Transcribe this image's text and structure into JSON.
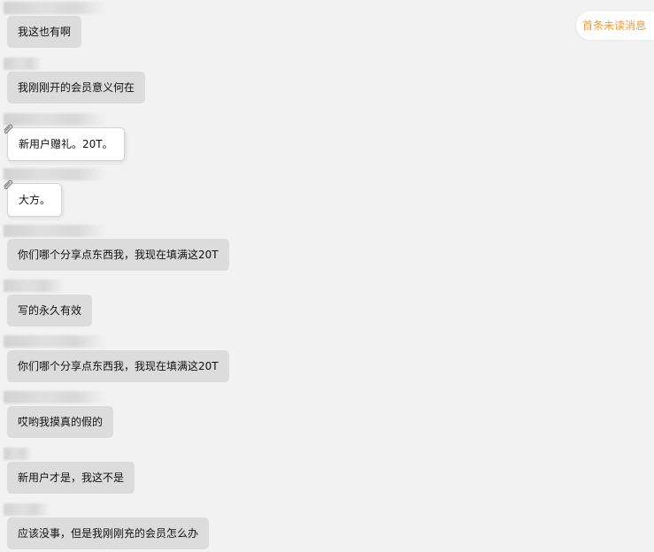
{
  "unread_label": "首条未读消息",
  "messages": [
    {
      "text": "我这也有啊"
    },
    {
      "text": "我刚刚开的会员意义何在"
    },
    {
      "text": "新用户赠礼。20T。"
    },
    {
      "text": "大方。"
    },
    {
      "text": "你们哪个分享点东西我，我现在填满这20T"
    },
    {
      "text": "写的永久有效"
    },
    {
      "text": "你们哪个分享点东西我，我现在填满这20T"
    },
    {
      "text": "哎哟我摸真的假的"
    },
    {
      "text": "新用户才是，我这不是"
    },
    {
      "text": "应该没事，但是我刚刚充的会员怎么办"
    }
  ],
  "icons": {
    "pin": "paperclip-icon"
  },
  "colors": {
    "background": "#f2f2f2",
    "bubble": "#dcdcdc",
    "pinned_bubble": "#ffffff",
    "unread_text": "#e99b3d"
  }
}
